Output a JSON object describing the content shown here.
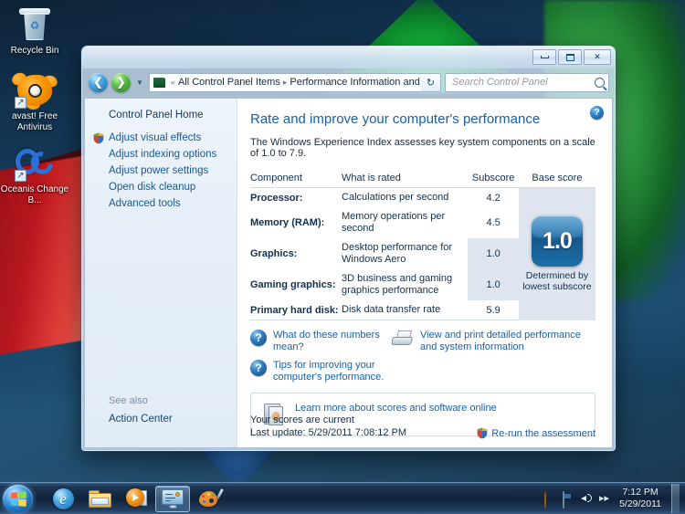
{
  "desktop": {
    "icons": [
      {
        "label": "Recycle Bin",
        "icon": "recycle-bin-icon",
        "shortcut": false
      },
      {
        "label": "avast! Free Antivirus",
        "icon": "avast-antivirus-icon",
        "shortcut": true
      },
      {
        "label": "Oceanis Change B...",
        "icon": "oceanis-change-background-icon",
        "shortcut": true
      }
    ]
  },
  "window": {
    "title_buttons": {
      "minimize": "Minimize",
      "maximize": "Maximize",
      "close": "Close"
    },
    "nav": {
      "back": "Back",
      "forward": "Forward",
      "recent_pages": "Recent pages",
      "refresh": "Refresh"
    },
    "breadcrumb": {
      "root_chevron": "«",
      "segments": [
        "All Control Panel Items",
        "Performance Information and Tools"
      ],
      "separator": "▸"
    },
    "search": {
      "placeholder": "Search Control Panel"
    },
    "help_button": "?"
  },
  "sidebar": {
    "home": "Control Panel Home",
    "items": [
      {
        "label": "Adjust visual effects",
        "shield": true
      },
      {
        "label": "Adjust indexing options",
        "shield": false
      },
      {
        "label": "Adjust power settings",
        "shield": false
      },
      {
        "label": "Open disk cleanup",
        "shield": false
      },
      {
        "label": "Advanced tools",
        "shield": false
      }
    ],
    "see_also_title": "See also",
    "see_also_items": [
      {
        "label": "Action Center"
      }
    ]
  },
  "content": {
    "title": "Rate and improve your computer's performance",
    "subtitle": "The Windows Experience Index assesses key system components on a scale of 1.0 to 7.9.",
    "table": {
      "headers": [
        "Component",
        "What is rated",
        "Subscore",
        "Base score"
      ],
      "rows": [
        {
          "component": "Processor:",
          "rated": "Calculations per second",
          "subscore": "4.2",
          "lowest": false
        },
        {
          "component": "Memory (RAM):",
          "rated": "Memory operations per second",
          "subscore": "4.5",
          "lowest": false
        },
        {
          "component": "Graphics:",
          "rated": "Desktop performance for Windows Aero",
          "subscore": "1.0",
          "lowest": true
        },
        {
          "component": "Gaming graphics:",
          "rated": "3D business and gaming graphics performance",
          "subscore": "1.0",
          "lowest": true
        },
        {
          "component": "Primary hard disk:",
          "rated": "Disk data transfer rate",
          "subscore": "5.9",
          "lowest": false
        }
      ],
      "base_score": "1.0",
      "base_caption": "Determined by lowest subscore"
    },
    "links": {
      "what_numbers_mean": "What do these numbers mean?",
      "tips": "Tips for improving your computer's performance.",
      "view_print": "View and print detailed performance and system information",
      "learn_more": "Learn more about scores and software online"
    },
    "footer": {
      "status": "Your scores are current",
      "last_update": "Last update: 5/29/2011 7:08:12 PM",
      "rerun": "Re-run the assessment"
    }
  },
  "taskbar": {
    "start": "Start",
    "buttons": [
      {
        "name": "internet-explorer",
        "label": "Internet Explorer",
        "active": false
      },
      {
        "name": "windows-explorer",
        "label": "Windows Explorer",
        "active": false
      },
      {
        "name": "windows-media-player",
        "label": "Windows Media Player",
        "active": false
      },
      {
        "name": "control-panel",
        "label": "Performance Information and Tools",
        "active": true
      },
      {
        "name": "paint",
        "label": "Paint",
        "active": false
      }
    ],
    "tray": [
      {
        "name": "network-icon",
        "label": "Network"
      },
      {
        "name": "avast-tray-icon",
        "label": "avast! Antivirus"
      },
      {
        "name": "action-center-icon",
        "label": "Action Center"
      },
      {
        "name": "volume-icon",
        "label": "Volume"
      },
      {
        "name": "show-hidden-icons-icon",
        "label": "Show hidden icons"
      }
    ],
    "clock": {
      "time": "7:12 PM",
      "date": "5/29/2011"
    }
  },
  "colors": {
    "accent_link": "#1861a8",
    "title_blue": "#1b5ea6",
    "highlight_row": "#dfe5ee",
    "badge_blue": "#1c6ca6"
  }
}
